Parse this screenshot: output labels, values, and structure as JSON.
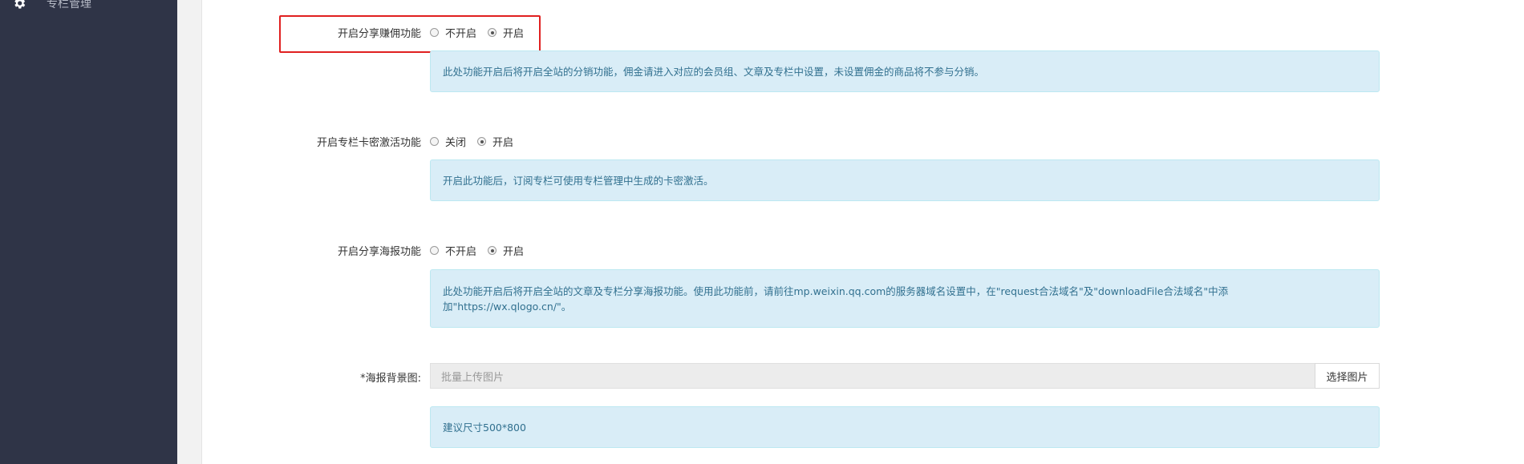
{
  "sidebar": {
    "item_label": "专栏管理",
    "item_icon": "gear-icon"
  },
  "share_commission": {
    "label": "开启分享赚佣功能",
    "options": [
      "不开启",
      "开启"
    ],
    "selected": "开启",
    "info": "此处功能开启后将开启全站的分销功能，佣金请进入对应的会员组、文章及专栏中设置，未设置佣金的商品将不参与分销。"
  },
  "card_activation": {
    "label": "开启专栏卡密激活功能",
    "options": [
      "关闭",
      "开启"
    ],
    "selected": "开启",
    "info": "开启此功能后，订阅专栏可使用专栏管理中生成的卡密激活。"
  },
  "share_poster": {
    "label": "开启分享海报功能",
    "options": [
      "不开启",
      "开启"
    ],
    "selected": "开启",
    "info_line1": "此处功能开启后将开启全站的文章及专栏分享海报功能。使用此功能前，请前往mp.weixin.qq.com的服务器域名设置中，在\"request合法域名\"及\"downloadFile合法域名\"中添",
    "info_line2": "加\"https://wx.qlogo.cn/\"。"
  },
  "poster_bg": {
    "label": "*海报背景图:",
    "placeholder": "批量上传图片",
    "button": "选择图片",
    "info": "建议尺寸500*800"
  },
  "colors": {
    "sidebar_bg": "#2f3447",
    "info_bg": "#d9edf7",
    "info_text": "#31708f",
    "highlight": "#e02020"
  }
}
